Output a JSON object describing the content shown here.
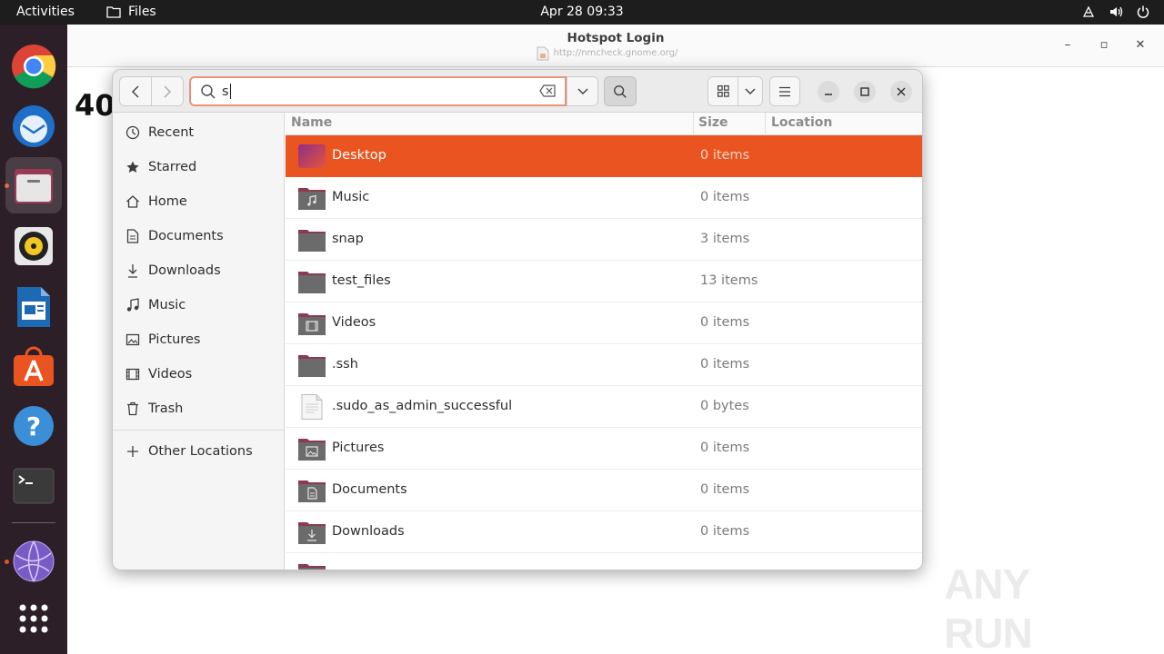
{
  "topbar": {
    "activities": "Activities",
    "app_name": "Files",
    "clock": "Apr 28  09:33",
    "tray_icons": [
      "network-icon",
      "volume-icon",
      "power-icon"
    ]
  },
  "dock": {
    "apps": [
      "Google Chrome",
      "Thunderbird",
      "Files",
      "Rhythmbox",
      "LibreOffice Writer",
      "Ubuntu Software",
      "Help",
      "Terminal",
      "Browser",
      "Show Applications"
    ]
  },
  "background_window": {
    "title": "Hotspot Login",
    "url": "http://nmcheck.gnome.org/",
    "page_text": "40"
  },
  "watermark": {
    "text": "ANY RUN"
  },
  "files": {
    "search": {
      "value": "s"
    },
    "sidebar": [
      {
        "label": "Recent",
        "icon": "clock-icon"
      },
      {
        "label": "Starred",
        "icon": "star-icon"
      },
      {
        "label": "Home",
        "icon": "home-icon"
      },
      {
        "label": "Documents",
        "icon": "document-icon"
      },
      {
        "label": "Downloads",
        "icon": "download-icon"
      },
      {
        "label": "Music",
        "icon": "music-icon"
      },
      {
        "label": "Pictures",
        "icon": "picture-icon"
      },
      {
        "label": "Videos",
        "icon": "video-icon"
      },
      {
        "label": "Trash",
        "icon": "trash-icon"
      },
      {
        "label": "Other Locations",
        "icon": "plus-icon"
      }
    ],
    "columns": {
      "name": "Name",
      "size": "Size",
      "location": "Location"
    },
    "rows": [
      {
        "name": "Desktop",
        "size": "0 items",
        "icon": "desktop-folder-icon",
        "selected": true
      },
      {
        "name": "Music",
        "size": "0 items",
        "icon": "music-folder-icon"
      },
      {
        "name": "snap",
        "size": "3 items",
        "icon": "folder-icon"
      },
      {
        "name": "test_files",
        "size": "13 items",
        "icon": "folder-icon"
      },
      {
        "name": "Videos",
        "size": "0 items",
        "icon": "video-folder-icon"
      },
      {
        "name": ".ssh",
        "size": "0 items",
        "icon": "folder-icon"
      },
      {
        "name": ".sudo_as_admin_successful",
        "size": "0 bytes",
        "icon": "text-file-icon"
      },
      {
        "name": "Pictures",
        "size": "0 items",
        "icon": "picture-folder-icon"
      },
      {
        "name": "Documents",
        "size": "0 items",
        "icon": "document-folder-icon"
      },
      {
        "name": "Downloads",
        "size": "0 items",
        "icon": "download-folder-icon"
      }
    ]
  },
  "colors": {
    "accent": "#e95420",
    "dock_bg": "#2c1f28",
    "topbar_bg": "#1d1d1d"
  }
}
